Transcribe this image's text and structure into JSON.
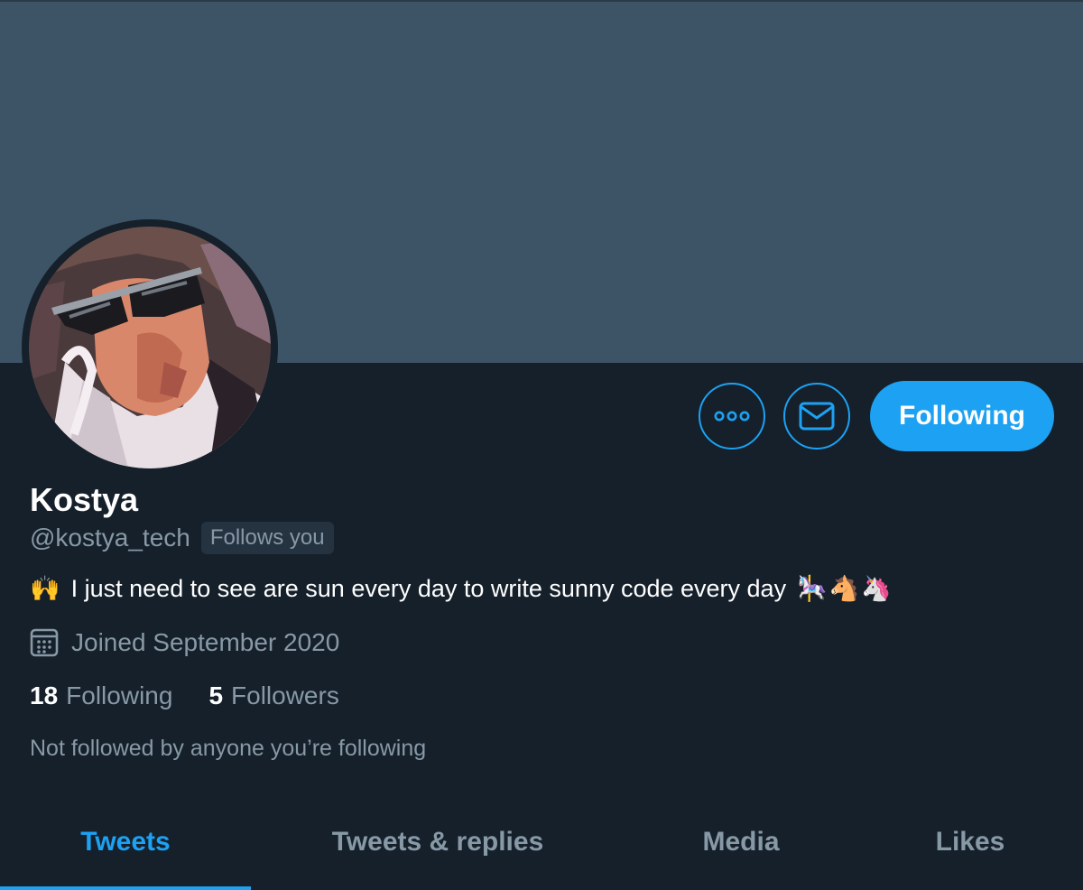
{
  "profile": {
    "name": "Kostya",
    "handle": "@kostya_tech",
    "follows_you_badge": "Follows you",
    "bio": {
      "prefix_emoji": "🙌",
      "text": "I just need to see are sun every day to write sunny code every day",
      "suffix_emojis": [
        "🎠",
        "🐴",
        "🦄"
      ]
    },
    "joined": "Joined September 2020",
    "stats": {
      "following_count": "18",
      "following_label": "Following",
      "followers_count": "5",
      "followers_label": "Followers"
    },
    "mutual_text": "Not followed by anyone you’re following"
  },
  "actions": {
    "more_icon": "more-dots-icon",
    "message_icon": "envelope-icon",
    "following_label": "Following"
  },
  "tabs": [
    {
      "label": "Tweets",
      "active": true
    },
    {
      "label": "Tweets & replies",
      "active": false
    },
    {
      "label": "Media",
      "active": false
    },
    {
      "label": "Likes",
      "active": false
    }
  ],
  "colors": {
    "background": "#15202b",
    "banner": "#3d5466",
    "accent": "#1da1f2",
    "secondary_text": "#8899a6"
  }
}
